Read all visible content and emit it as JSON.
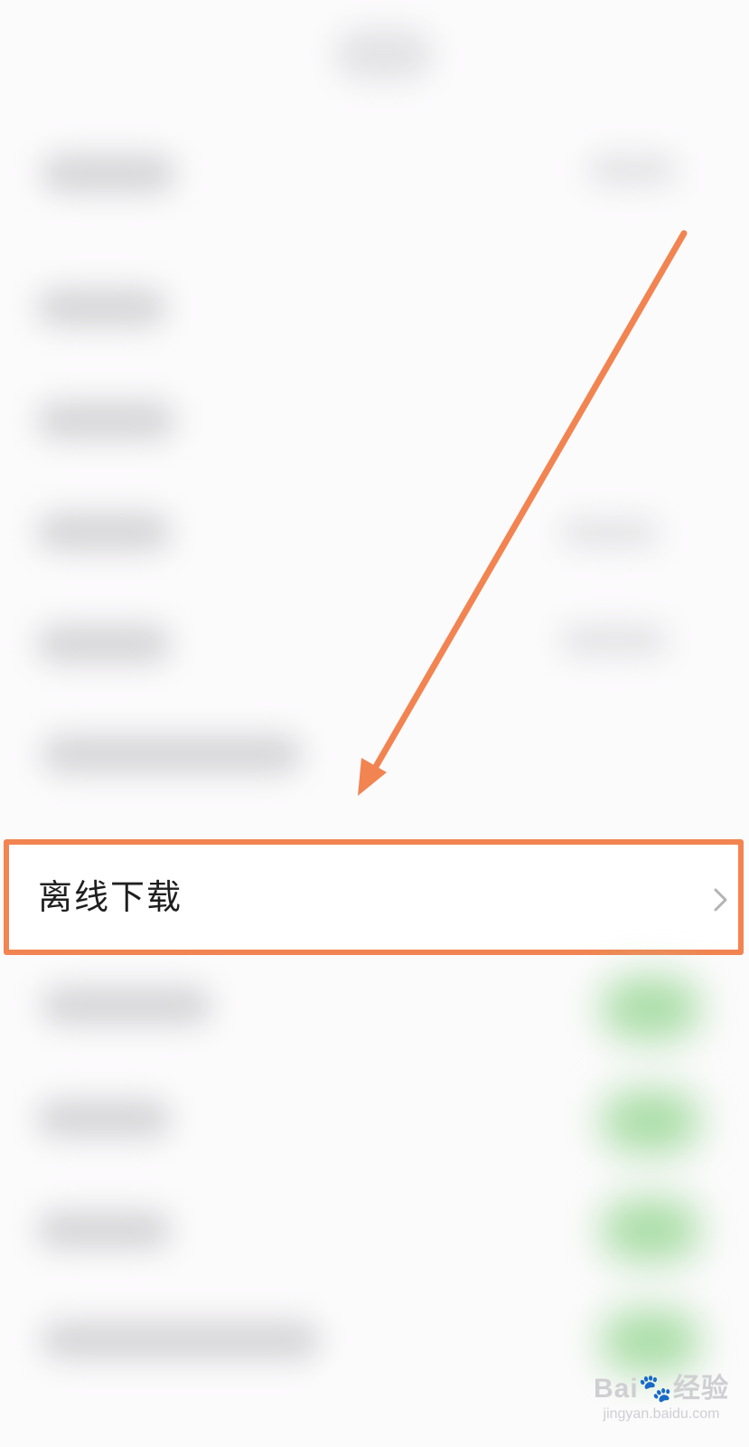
{
  "settings": {
    "highlighted_item": {
      "label": "离线下载",
      "chevron": "chevron-right-icon"
    }
  },
  "annotation": {
    "arrow_color": "#f28451",
    "box_color": "#f28451"
  },
  "watermark": {
    "brand": "Bai",
    "paw": "paw-icon",
    "brand_suffix": "经验",
    "url": "jingyan.baidu.com"
  }
}
